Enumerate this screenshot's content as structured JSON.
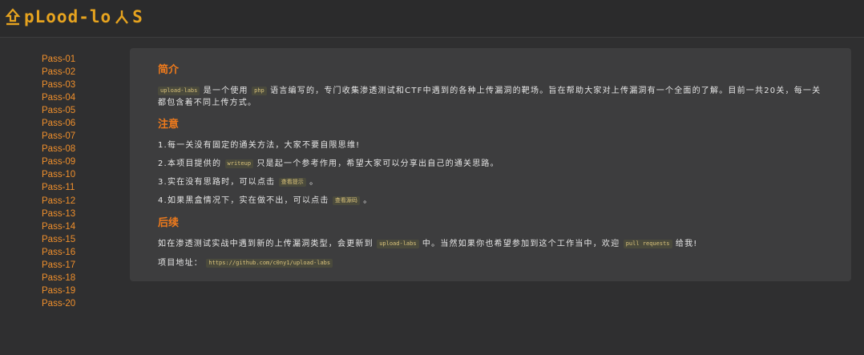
{
  "header": {
    "logo_text": "pLood-lo",
    "logo_tail": "S"
  },
  "sidebar": {
    "items": [
      "Pass-01",
      "Pass-02",
      "Pass-03",
      "Pass-04",
      "Pass-05",
      "Pass-06",
      "Pass-07",
      "Pass-08",
      "Pass-09",
      "Pass-10",
      "Pass-11",
      "Pass-12",
      "Pass-13",
      "Pass-14",
      "Pass-15",
      "Pass-16",
      "Pass-17",
      "Pass-18",
      "Pass-19",
      "Pass-20"
    ]
  },
  "intro": {
    "title": "简介",
    "code1": "upload-labs",
    "text1": " 是一个使用 ",
    "code2": "php",
    "text2": " 语言编写的，专门收集渗透测试和CTF中遇到的各种上传漏洞的靶场。旨在帮助大家对上传漏洞有一个全面的了解。目前一共20关，每一关都包含着不同上传方式。"
  },
  "notes": {
    "title": "注意",
    "n1": "1.每一关没有固定的通关方法，大家不要自限思维!",
    "n2_a": "2.本项目提供的 ",
    "n2_code": "writeup",
    "n2_b": " 只是起一个参考作用，希望大家可以分享出自己的通关思路。",
    "n3_a": "3.实在没有思路时，可以点击 ",
    "n3_code": "查看提示",
    "n3_b": " 。",
    "n4_a": "4.如果黑盒情况下，实在做不出，可以点击 ",
    "n4_code": "查看源码",
    "n4_b": " 。"
  },
  "followup": {
    "title": "后续",
    "f1_a": "如在渗透测试实战中遇到新的上传漏洞类型，会更新到 ",
    "f1_code1": "upload-labs",
    "f1_b": " 中。当然如果你也希望参加到这个工作当中，欢迎 ",
    "f1_code2": "pull requests",
    "f1_c": " 给我!",
    "f2_a": "项目地址：",
    "f2_code": "https://github.com/c0ny1/upload-labs"
  },
  "colors": {
    "accent": "#ee7a1c",
    "link": "#ef8f2c",
    "logo": "#e6a31f",
    "bg": "#2f2f30",
    "panel": "#3d3d3e"
  },
  "icons": {
    "logo": "upload-arrow-icon"
  }
}
